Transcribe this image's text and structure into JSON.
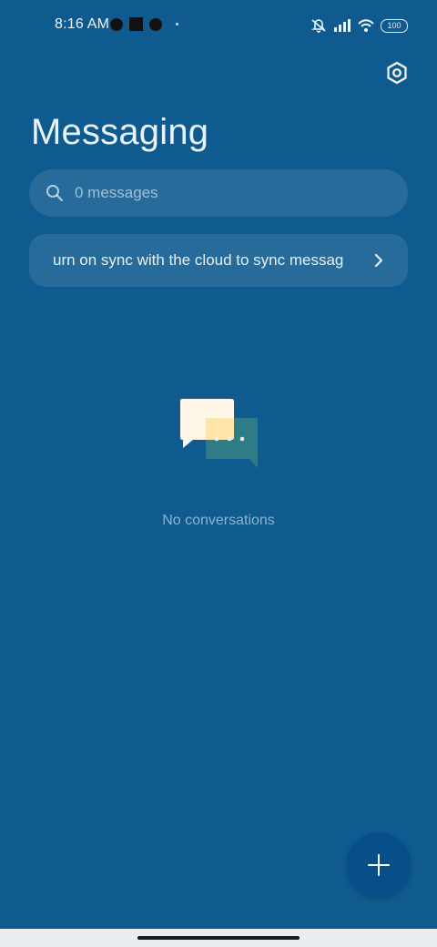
{
  "status_bar": {
    "time": "8:16 AM",
    "battery": "100"
  },
  "header": {
    "title": "Messaging"
  },
  "search": {
    "placeholder": "0 messages"
  },
  "sync_banner": {
    "text": "urn on sync with the cloud to sync messag"
  },
  "empty_state": {
    "text": "No conversations"
  },
  "colors": {
    "background": "#0f5b8f",
    "fab": "#074f88"
  },
  "icons": {
    "settings": "hexagon-gear-icon",
    "search": "search-icon",
    "chevron": "chevron-right-icon",
    "fab": "plus-icon"
  }
}
